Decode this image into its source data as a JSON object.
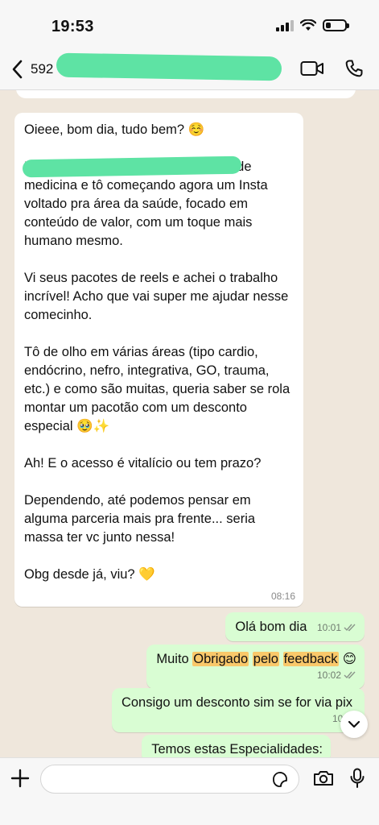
{
  "status_bar": {
    "time": "19:53"
  },
  "header": {
    "contact_name": "592"
  },
  "incoming_message": {
    "paragraphs": [
      "Oieee, bom dia, tudo bem? ☺️",
      "Me chamo (redigido) sou estudante de medicina e tô começando agora um Insta voltado pra área da saúde, focado em conteúdo de valor, com um toque mais humano mesmo.",
      "Vi seus pacotes de reels e achei o trabalho incrível! Acho que vai super me ajudar nesse comecinho.",
      "Tô de olho em várias áreas (tipo cardio, endócrino, nefro, integrativa, GO, trauma, etc.) e como são muitas, queria saber se rola montar um pacotão com um desconto especial 🥹✨",
      "Ah! E o acesso é vitalício ou tem prazo?",
      "Dependendo, até podemos pensar em alguma parceria mais pra frente... seria massa ter vc junto nessa!",
      "Obg desde já, viu? 💛"
    ],
    "time": "08:16"
  },
  "outgoing_messages": [
    {
      "text": "Olá bom dia",
      "time": "10:01"
    },
    {
      "text_parts": [
        "Muito ",
        "Obrigado",
        " ",
        "pelo",
        " ",
        "feedback",
        " 😊"
      ],
      "time": "10:02"
    },
    {
      "text": "Consigo um desconto sim se for via pix",
      "time": "10:02"
    },
    {
      "text": "Temos estas Especialidades:"
    }
  ],
  "input": {
    "placeholder": ""
  },
  "icons": {
    "back": "chevron-left-icon",
    "video": "video-call-icon",
    "phone": "phone-icon",
    "plus": "plus-icon",
    "sticker": "sticker-icon",
    "camera": "camera-icon",
    "mic": "mic-icon",
    "scroll": "chevron-down-icon",
    "read": "double-check-icon"
  },
  "colors": {
    "chat_bg": "#efe7dc",
    "outgoing_bubble": "#d9fdd3",
    "incoming_bubble": "#ffffff",
    "highlight": "#f9c86a",
    "redaction": "#5ee3a4"
  }
}
